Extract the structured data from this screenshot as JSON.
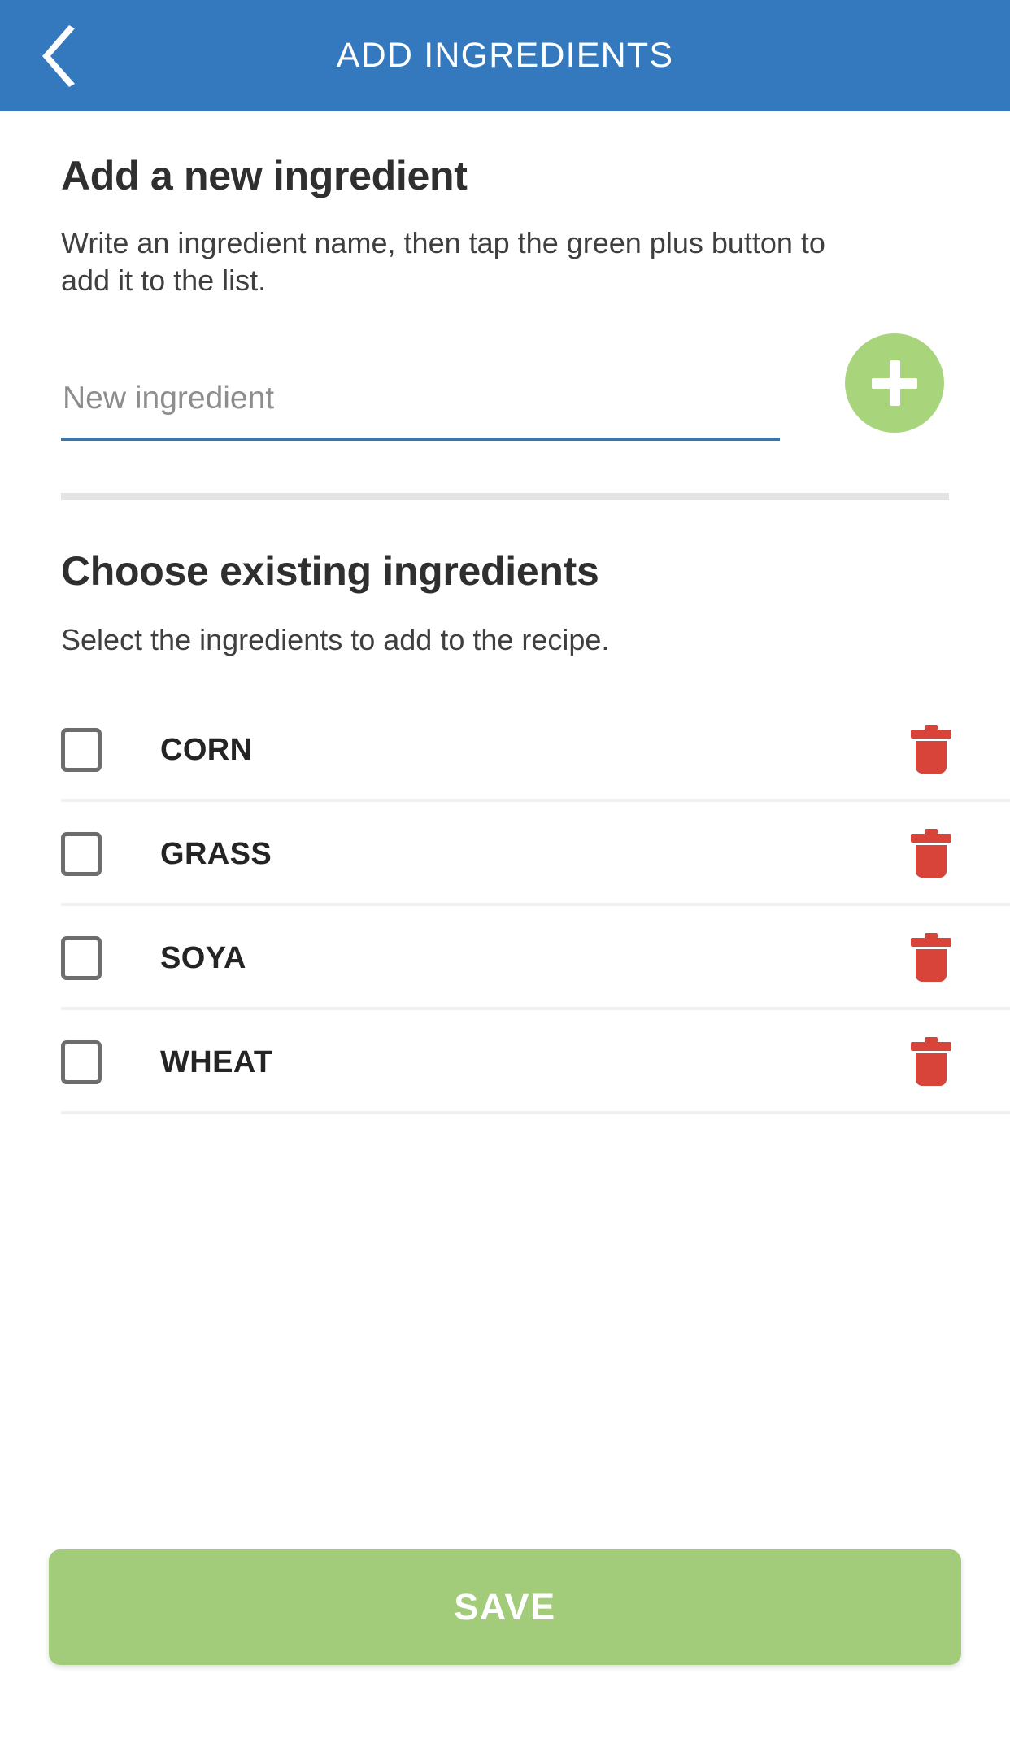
{
  "appbar": {
    "back_icon": "chevron-left-icon",
    "title": "ADD INGREDIENTS"
  },
  "add_new_section": {
    "heading": "Add a new ingredient",
    "description": "Write an ingredient name, then tap the green plus button to add it to the list.",
    "input_placeholder": "New ingredient",
    "input_value": "",
    "add_button_icon": "plus-icon"
  },
  "choose_section": {
    "heading": "Choose existing ingredients",
    "description": "Select the ingredients to add to the recipe.",
    "ingredients": [
      {
        "label": "CORN",
        "checked": false,
        "delete_icon": "trash-icon"
      },
      {
        "label": "GRASS",
        "checked": false,
        "delete_icon": "trash-icon"
      },
      {
        "label": "SOYA",
        "checked": false,
        "delete_icon": "trash-icon"
      },
      {
        "label": "WHEAT",
        "checked": false,
        "delete_icon": "trash-icon"
      }
    ]
  },
  "footer": {
    "save_label": "SAVE"
  },
  "colors": {
    "appbar_blue": "#3479bd",
    "accent_green": "#a2cc79",
    "plus_green": "#a8d57c",
    "delete_red": "#d9443a",
    "input_underline": "#3a77a8",
    "checkbox_border": "#6d6d6d",
    "divider": "#f0f0f0",
    "section_divider": "#e4e4e4"
  }
}
